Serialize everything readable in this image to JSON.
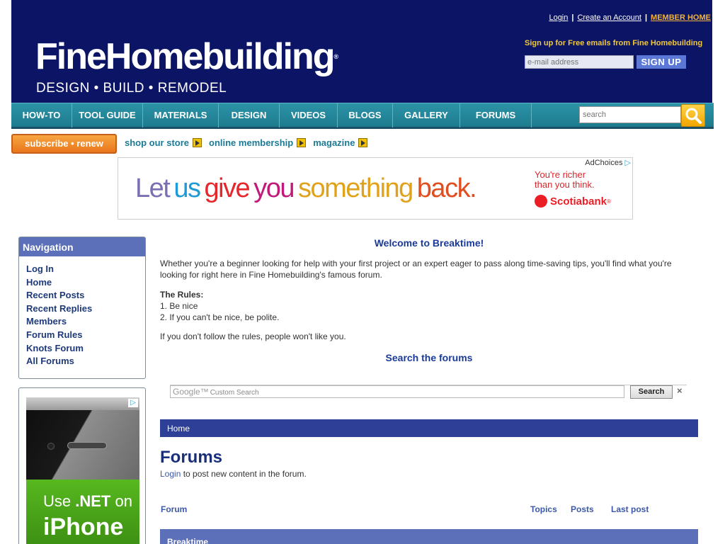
{
  "header": {
    "logo": "FineHomebuilding",
    "logo_mark": "®",
    "tagline": "DESIGN • BUILD • REMODEL",
    "links": {
      "login": "Login",
      "create_account": "Create an Account",
      "member_home": "MEMBER HOME",
      "separator": "|"
    },
    "signup_text": "Sign up for Free emails from Fine Homebuilding",
    "email_placeholder": "e-mail address",
    "signup_button": "SIGN UP"
  },
  "nav": {
    "items": [
      "HOW-TO",
      "TOOL GUIDE",
      "MATERIALS",
      "DESIGN",
      "VIDEOS",
      "BLOGS",
      "GALLERY",
      "FORUMS"
    ],
    "search_placeholder": "search"
  },
  "subnav": {
    "subscribe": "subscribe • renew",
    "links": [
      "shop our store",
      "online membership",
      "magazine"
    ]
  },
  "ad": {
    "adchoices": "AdChoices",
    "headline_words": [
      {
        "text": "Let",
        "color": "#7b6fb3"
      },
      {
        "text": "us",
        "color": "#1e9ad6"
      },
      {
        "text": "give",
        "color": "#e6262d"
      },
      {
        "text": "you",
        "color": "#c2197b"
      },
      {
        "text": "something",
        "color": "#e0a21a"
      },
      {
        "text": "back.",
        "color": "#e04e1f"
      }
    ],
    "side_line1": "You're richer",
    "side_line2": "than you think.",
    "brand": "Scotiabank",
    "brand_mark": "®"
  },
  "sidebar": {
    "title": "Navigation",
    "items": [
      "Log In",
      "Home",
      "Recent Posts",
      "Recent Replies",
      "Members",
      "Forum Rules",
      "Knots Forum",
      "All Forums"
    ],
    "ad_line1_a": "Use ",
    "ad_line1_b": ".NET",
    "ad_line1_c": " on",
    "ad_line2": "iPhone"
  },
  "main": {
    "welcome": "Welcome to Breaktime!",
    "intro": "Whether you're a beginner looking for help with your first project or an expert eager to pass along time-saving tips, you'll find what you're looking for right here in Fine Homebuilding's famous forum.",
    "rules_title": "The Rules:",
    "rule1": "1. Be nice",
    "rule2": "2. If you can't be nice, be polite.",
    "follow": "If you don't follow the rules, people won't like you.",
    "search_heading": "Search the forums",
    "cse_brand": "Google™",
    "cse_placeholder": "Custom Search",
    "cse_button": "Search",
    "cse_close": "×",
    "breadcrumb": "Home",
    "forums_title": "Forums",
    "login_link": "Login",
    "login_note": " to post new content in the forum.",
    "columns": {
      "forum": "Forum",
      "topics": "Topics",
      "posts": "Posts",
      "last_post": "Last post"
    },
    "first_forum": "Breaktime"
  }
}
